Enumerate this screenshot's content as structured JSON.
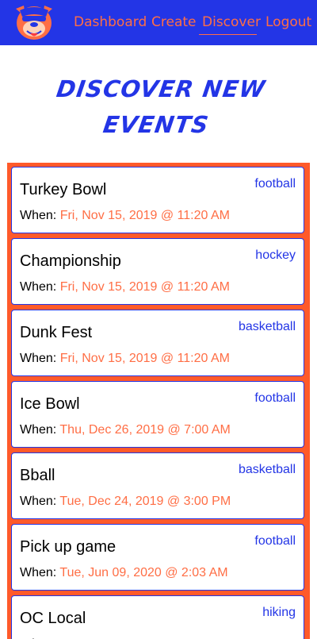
{
  "nav": {
    "logo_icon": "dog-mascot-icon",
    "links": [
      "Dashboard",
      "Create",
      "Discover",
      "Logout"
    ],
    "active": "Discover"
  },
  "page": {
    "title": "Discover New Events"
  },
  "events": [
    {
      "title": "Turkey Bowl",
      "sport": "football",
      "when_label": "When:",
      "date": "Fri, Nov 15, 2019 @ 11:20 AM"
    },
    {
      "title": "Championship",
      "sport": "hockey",
      "when_label": "When:",
      "date": "Fri, Nov 15, 2019 @ 11:20 AM"
    },
    {
      "title": "Dunk Fest",
      "sport": "basketball",
      "when_label": "When:",
      "date": "Fri, Nov 15, 2019 @ 11:20 AM"
    },
    {
      "title": "Ice Bowl",
      "sport": "football",
      "when_label": "When:",
      "date": "Thu, Dec 26, 2019 @ 7:00 AM"
    },
    {
      "title": "Bball",
      "sport": "basketball",
      "when_label": "When:",
      "date": "Tue, Dec 24, 2019 @ 3:00 PM"
    },
    {
      "title": "Pick up game",
      "sport": "football",
      "when_label": "When:",
      "date": "Tue, Jun 09, 2020 @ 2:03 AM"
    },
    {
      "title": "OC Local",
      "sport": "hiking",
      "when_label": "When:",
      "date": ""
    }
  ],
  "colors": {
    "primary": "#2335e6",
    "accent": "#ff6e45",
    "list_border": "#ff5a2a"
  }
}
